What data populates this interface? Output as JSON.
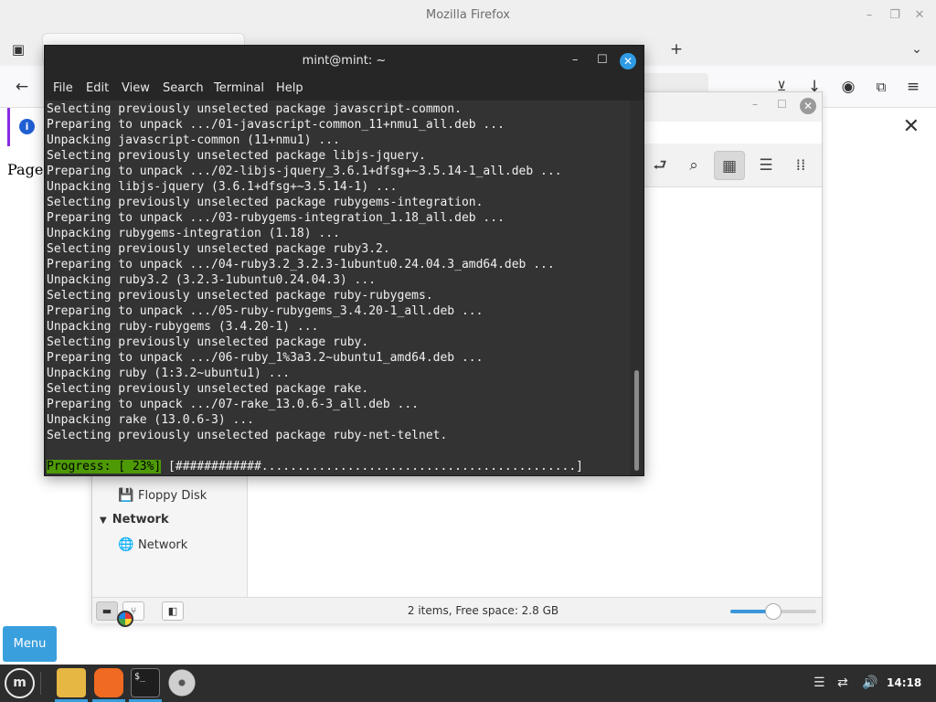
{
  "firefox": {
    "title": "Mozilla Firefox",
    "page_text": "Page"
  },
  "file_manager": {
    "sidebar": {
      "floppy_label": "Floppy Disk",
      "network_header": "Network",
      "network_item": "Network"
    },
    "status": "2 items, Free space: 2.8 GB",
    "zoom_level": 0.5
  },
  "terminal": {
    "title": "mint@mint: ~",
    "menu": [
      "File",
      "Edit",
      "View",
      "Search",
      "Terminal",
      "Help"
    ],
    "lines": [
      "Selecting previously unselected package javascript-common.",
      "Preparing to unpack .../01-javascript-common_11+nmu1_all.deb ...",
      "Unpacking javascript-common (11+nmu1) ...",
      "Selecting previously unselected package libjs-jquery.",
      "Preparing to unpack .../02-libjs-jquery_3.6.1+dfsg+~3.5.14-1_all.deb ...",
      "Unpacking libjs-jquery (3.6.1+dfsg+~3.5.14-1) ...",
      "Selecting previously unselected package rubygems-integration.",
      "Preparing to unpack .../03-rubygems-integration_1.18_all.deb ...",
      "Unpacking rubygems-integration (1.18) ...",
      "Selecting previously unselected package ruby3.2.",
      "Preparing to unpack .../04-ruby3.2_3.2.3-1ubuntu0.24.04.3_amd64.deb ...",
      "Unpacking ruby3.2 (3.2.3-1ubuntu0.24.04.3) ...",
      "Selecting previously unselected package ruby-rubygems.",
      "Preparing to unpack .../05-ruby-rubygems_3.4.20-1_all.deb ...",
      "Unpacking ruby-rubygems (3.4.20-1) ...",
      "Selecting previously unselected package ruby.",
      "Preparing to unpack .../06-ruby_1%3a3.2~ubuntu1_amd64.deb ...",
      "Unpacking ruby (1:3.2~ubuntu1) ...",
      "Selecting previously unselected package rake.",
      "Preparing to unpack .../07-rake_13.0.6-3_all.deb ...",
      "Unpacking rake (13.0.6-3) ...",
      "Selecting previously unselected package ruby-net-telnet."
    ],
    "progress_label": "Progress: [ 23%]",
    "progress_bar": " [############............................................]"
  },
  "menu_button": "Menu",
  "taskbar": {
    "clock": "14:18"
  },
  "colors": {
    "accent": "#3a9fdd",
    "terminal_bg": "#333333",
    "progress_green": "#4e9a06"
  }
}
